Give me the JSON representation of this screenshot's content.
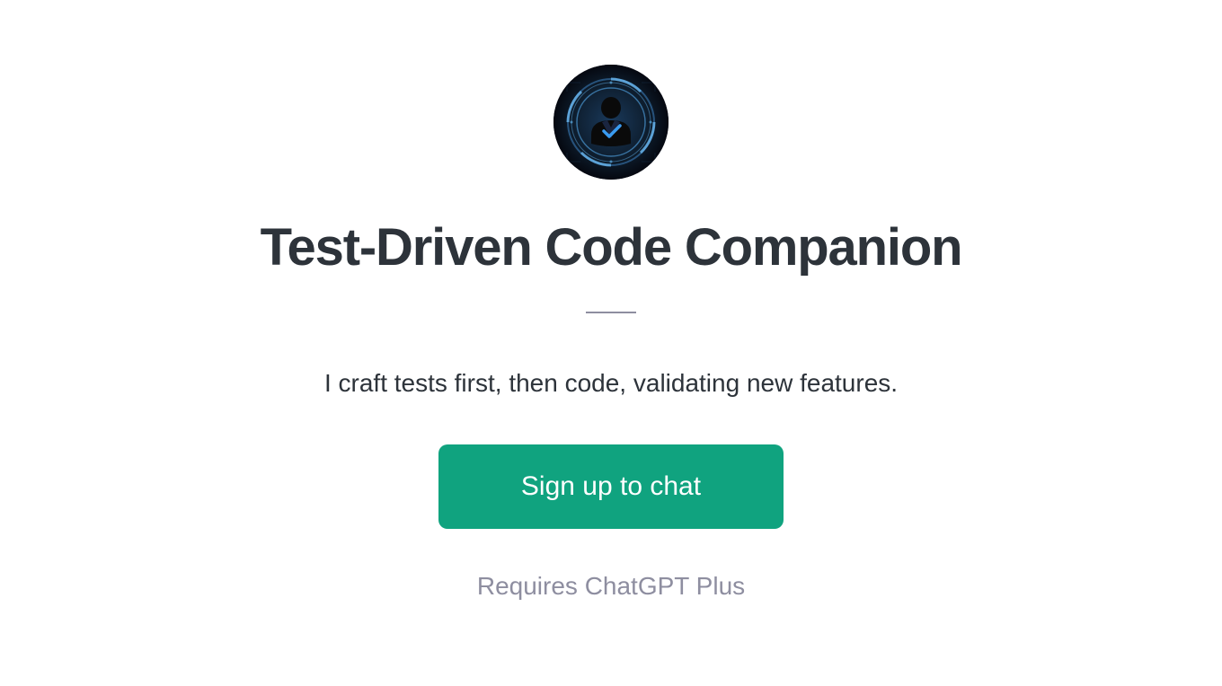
{
  "profile": {
    "title": "Test-Driven Code Companion",
    "description": "I craft tests first, then code, validating new features.",
    "avatar_alt": "companion-avatar"
  },
  "cta": {
    "button_label": "Sign up to chat",
    "requirement_text": "Requires ChatGPT Plus"
  },
  "colors": {
    "accent": "#10a37f",
    "text_primary": "#2d333a",
    "text_secondary": "#8e8ea0"
  }
}
